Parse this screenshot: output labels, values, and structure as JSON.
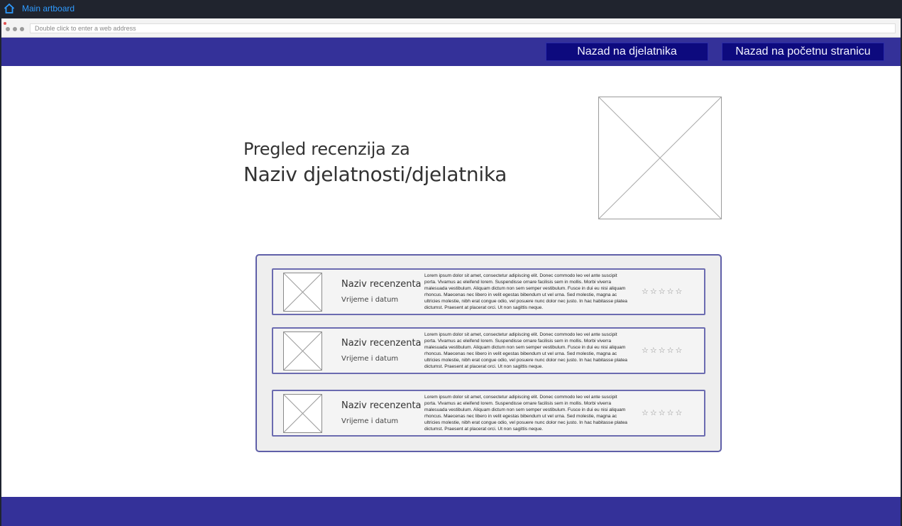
{
  "toolbar": {
    "title": "Main artboard",
    "home_icon": "home-icon"
  },
  "browser": {
    "address_placeholder": "Double click to enter a web address"
  },
  "nav": {
    "back_to_worker": "Nazad na djelatnika",
    "back_to_home": "Nazad na početnu stranicu"
  },
  "page": {
    "heading_prefix": "Pregled recenzija za",
    "heading_name": "Naziv djelatnosti/djelatnika"
  },
  "reviews": [
    {
      "name": "Naziv recenzenta",
      "date": "Vrijeme i datum",
      "text": "Lorem ipsum dolor sit amet, consectetur adipiscing elit. Donec commodo leo vel ante suscipit porta. Vivamus ac eleifend lorem. Suspendisse ornare facilisis sem in mollis. Morbi viverra malesuada vestibulum. Aliquam dictum non sem semper vestibulum. Fusce in dui eu nisi aliquam rhoncus. Maecenas nec libero in velit egestas bibendum ut vel urna. Sed molestie, magna ac ultricies molestie, nibh erat congue odio, vel posuere nunc dolor nec justo. In hac habitasse platea dictumst. Praesent at placerat orci. Ut non sagittis neque.",
      "stars": "☆☆☆☆☆"
    },
    {
      "name": "Naziv recenzenta",
      "date": "Vrijeme i datum",
      "text": "Lorem ipsum dolor sit amet, consectetur adipiscing elit. Donec commodo leo vel ante suscipit porta. Vivamus ac eleifend lorem. Suspendisse ornare facilisis sem in mollis. Morbi viverra malesuada vestibulum. Aliquam dictum non sem semper vestibulum. Fusce in dui eu nisi aliquam rhoncus. Maecenas nec libero in velit egestas bibendum ut vel urna. Sed molestie, magna ac ultricies molestie, nibh erat congue odio, vel posuere nunc dolor nec justo. In hac habitasse platea dictumst. Praesent at placerat orci. Ut non sagittis neque.",
      "stars": "☆☆☆☆☆"
    },
    {
      "name": "Naziv recenzenta",
      "date": "Vrijeme i datum",
      "text": "Lorem ipsum dolor sit amet, consectetur adipiscing elit. Donec commodo leo vel ante suscipit porta. Vivamus ac eleifend lorem. Suspendisse ornare facilisis sem in mollis. Morbi viverra malesuada vestibulum. Aliquam dictum non sem semper vestibulum. Fusce in dui eu nisi aliquam rhoncus. Maecenas nec libero in velit egestas bibendum ut vel urna. Sed molestie, magna ac ultricies molestie, nibh erat congue odio, vel posuere nunc dolor nec justo. In hac habitasse platea dictumst. Praesent at placerat orci. Ut non sagittis neque.",
      "stars": "☆☆☆☆☆"
    }
  ],
  "colors": {
    "nav_bg": "#343199",
    "button_bg": "#0d0a7e",
    "card_border": "#6b6bb0",
    "link_blue": "#2f9bff"
  }
}
